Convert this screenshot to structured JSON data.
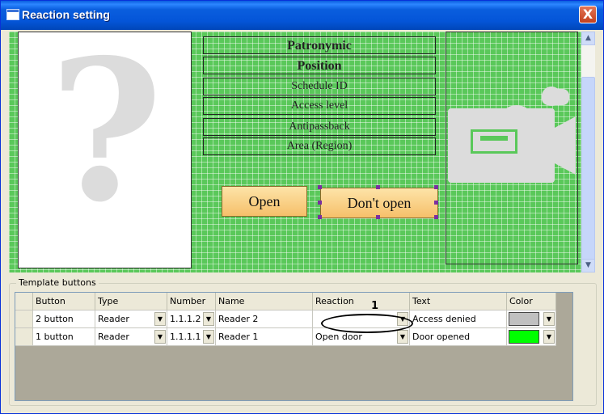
{
  "window": {
    "title": "Reaction setting",
    "close_label": "X"
  },
  "canvas": {
    "question_mark": "?",
    "fields": [
      {
        "label": "Patronymic",
        "style": "bold"
      },
      {
        "label": "Position",
        "style": "bold"
      },
      {
        "label": "Schedule ID",
        "style": "reg"
      },
      {
        "label": "Access level",
        "style": "reg"
      },
      {
        "label": "Antipassback",
        "style": "reg"
      },
      {
        "label": "Area (Region)",
        "style": "reg"
      }
    ],
    "open_button": "Open",
    "dont_open_button": "Don't open",
    "camera_icon": "video-camera-icon",
    "grid_color": "#5ac85a"
  },
  "template_buttons": {
    "group_label": "Template buttons",
    "annotation_number": "1",
    "columns": [
      "Button",
      "Type",
      "Number",
      "Name",
      "Reaction",
      "Text",
      "Color"
    ],
    "rows": [
      {
        "button": "2 button",
        "type": "Reader",
        "number": "1.1.1.2",
        "name": "Reader 2",
        "reaction": "",
        "text": "Access denied",
        "color": "#c0c0c0"
      },
      {
        "button": "1 button",
        "type": "Reader",
        "number": "1.1.1.1",
        "name": "Reader 1",
        "reaction": "Open door",
        "text": "Door opened",
        "color": "#00ff00"
      }
    ]
  }
}
